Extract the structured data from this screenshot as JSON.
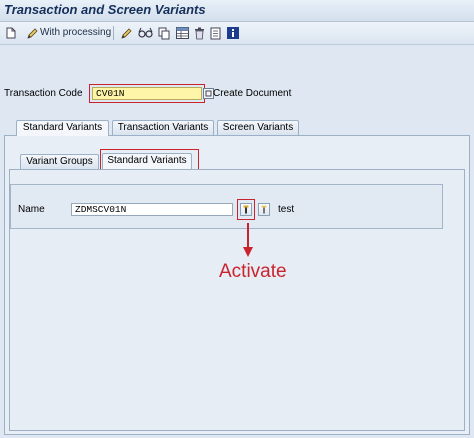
{
  "window": {
    "title": "Transaction and Screen Variants"
  },
  "toolbar": {
    "with_processing": "With processing"
  },
  "form": {
    "transaction_code_label": "Transaction Code",
    "transaction_code_value": "CV01N",
    "transaction_description": "Create Document"
  },
  "outer_tabs": [
    "Standard Variants",
    "Transaction Variants",
    "Screen Variants"
  ],
  "inner_tabs": [
    "Variant Groups",
    "Standard Variants"
  ],
  "standard_variant": {
    "name_label": "Name",
    "name_value": "ZDMSCV01N",
    "description": "test"
  },
  "annotation": {
    "label": "Activate",
    "color": "#c9242e"
  }
}
